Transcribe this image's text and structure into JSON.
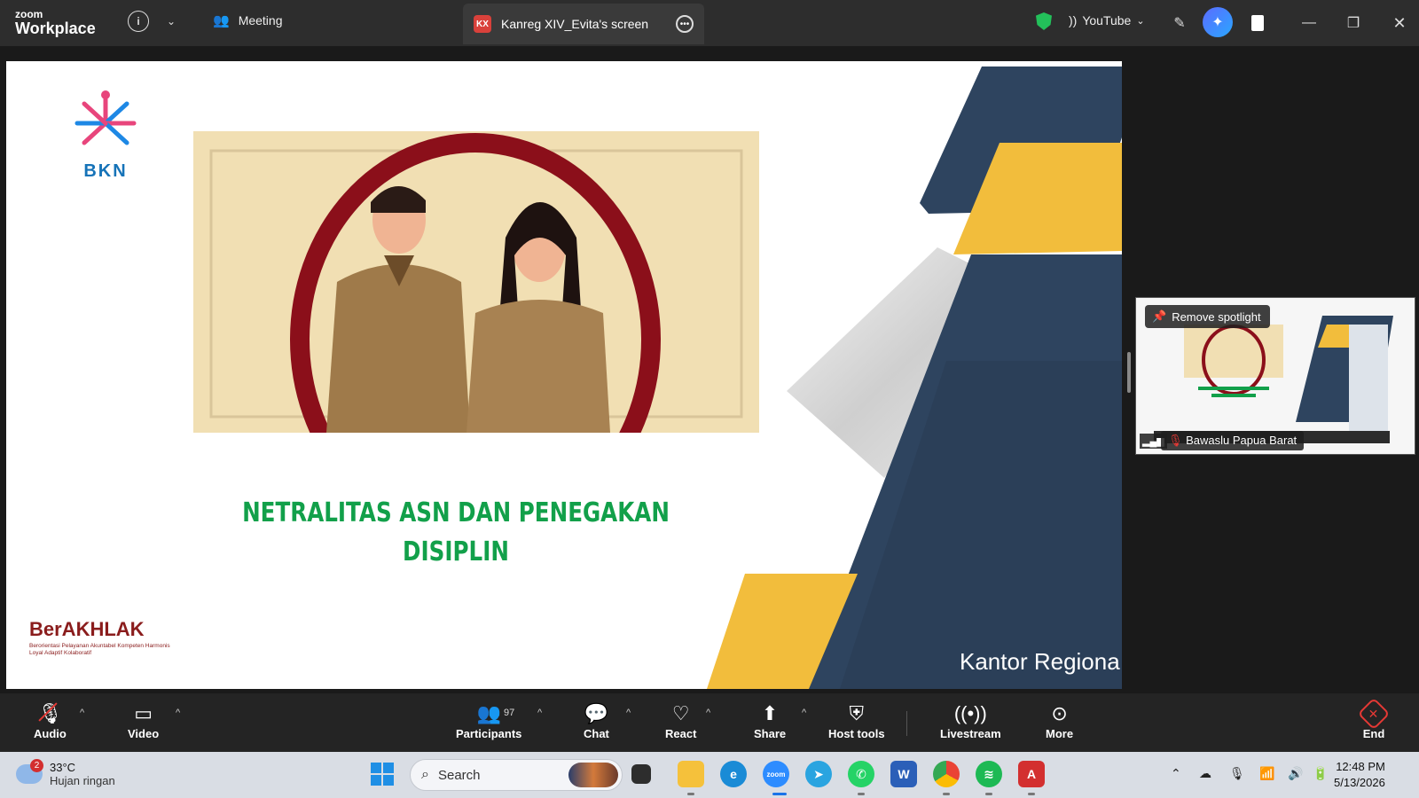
{
  "titlebar": {
    "logo_top": "zoom",
    "logo_bottom": "Workplace",
    "meeting_label": "Meeting",
    "share_tab_badge": "KX",
    "share_tab_label": "Kanreg XIV_Evita's screen",
    "stream_label": "YouTube"
  },
  "slide": {
    "logo_text": "BKN",
    "title_line1": "NETRALITAS ASN DAN PENEGAKAN",
    "title_line2": "DISIPLIN",
    "berakhlak": "BerAKHLAK",
    "berakhlak_sub": "Berorientasi Pelayanan Akuntabel Kompeten Harmonis Loyal Adaptif Kolaboratif",
    "footer_text": "Kantor Regiona"
  },
  "thumbnail": {
    "spotlight_label": "Remove spotlight",
    "participant_name": "Bawaslu Papua Barat"
  },
  "toolbar": {
    "audio": "Audio",
    "video": "Video",
    "participants": "Participants",
    "participants_count": "97",
    "chat": "Chat",
    "react": "React",
    "share": "Share",
    "host_tools": "Host tools",
    "livestream": "Livestream",
    "more": "More",
    "end": "End"
  },
  "taskbar": {
    "weather_badge": "2",
    "temperature": "33°C",
    "weather_desc": "Hujan ringan",
    "search_placeholder": "Search",
    "time": "12:48 PM",
    "date": "5/13/2026"
  },
  "colors": {
    "slide_navy": "#2e445f",
    "slide_yellow": "#f2bd3c",
    "slide_title_green": "#12a04a",
    "end_red": "#e53935"
  }
}
